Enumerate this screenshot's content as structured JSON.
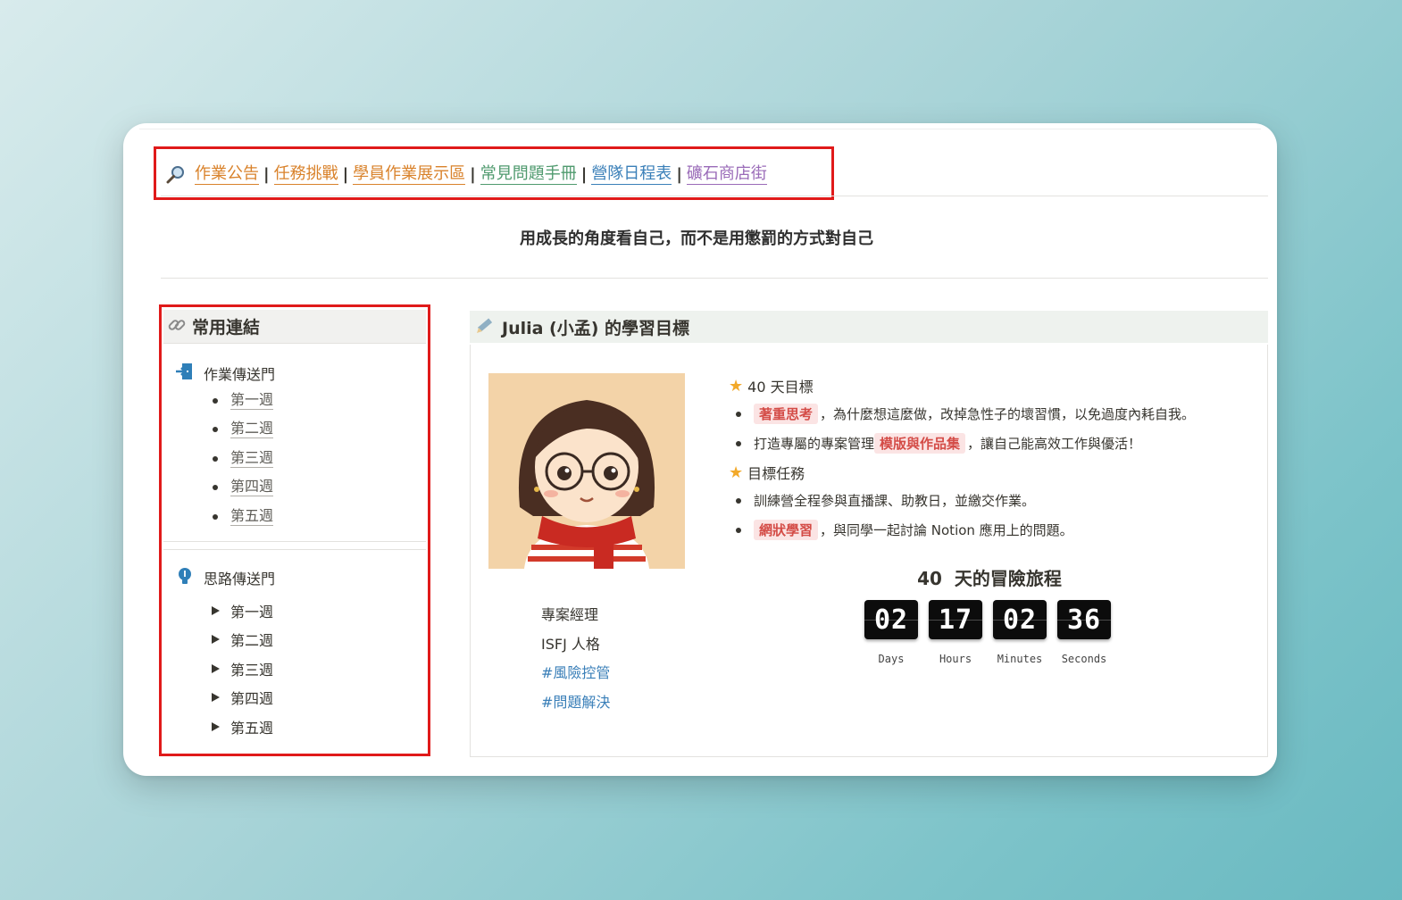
{
  "nav": {
    "links": [
      "作業公告",
      "任務挑戰",
      "學員作業展示區",
      "常見問題手冊",
      "營隊日程表",
      "礦石商店街"
    ],
    "separator": "|"
  },
  "quote": "用成長的角度看自己，而不是用懲罰的方式對自己",
  "sidebar": {
    "title": "常用連結",
    "section1": {
      "title": "作業傳送門",
      "items": [
        "第一週",
        "第二週",
        "第三週",
        "第四週",
        "第五週"
      ]
    },
    "section2": {
      "title": "思路傳送門",
      "items": [
        "第一週",
        "第二週",
        "第三週",
        "第四週",
        "第五週"
      ]
    }
  },
  "main": {
    "title": "Julia (小孟) 的學習目標",
    "profile": {
      "role": "專案經理",
      "personality": "ISFJ 人格",
      "tags": [
        "#風險控管",
        "#問題解決"
      ]
    },
    "goals": {
      "heading1": "40 天目標",
      "g1_highlight": "著重思考",
      "g1_text": "，為什麼想這麼做，改掉急性子的壞習慣，以免過度內耗自我。",
      "g2_pre": "打造專屬的專案管理",
      "g2_highlight": "模版與作品集",
      "g2_text": "，讓自己能高效工作與優活！",
      "heading2": "目標任務",
      "g3_text": "訓練營全程參與直播課、助教日，並繳交作業。",
      "g4_highlight": "網狀學習",
      "g4_text": "，與同學一起討論 Notion 應用上的問題。"
    },
    "countdown": {
      "num": "40",
      "title": "天的冒險旅程",
      "days": "02",
      "hours": "17",
      "minutes": "02",
      "seconds": "36",
      "labels": [
        "Days",
        "Hours",
        "Minutes",
        "Seconds"
      ]
    }
  },
  "colors": {
    "highlight_box": "#e01a1a",
    "nav_orange": "#d9822b",
    "nav_green": "#4f9a6e",
    "nav_blue": "#3a7fb8",
    "nav_purple": "#9a6bb8",
    "tag_blue": "#3a7fb8",
    "highlight_red": "#d44c47"
  },
  "icons": {
    "nav": "magnifier-icon",
    "sidebar": "link-icon",
    "section1": "enter-door-icon",
    "section2": "lightbulb-icon",
    "main": "pencil-icon",
    "goal": "star-icon"
  }
}
